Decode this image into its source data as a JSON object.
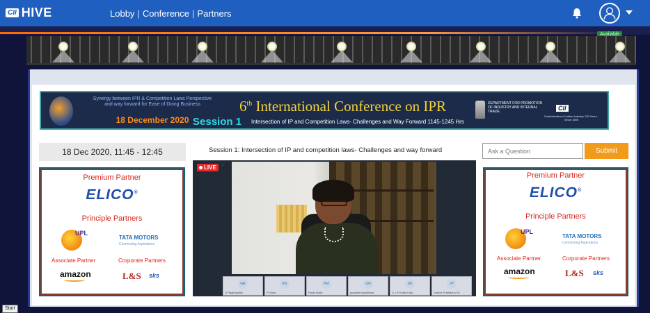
{
  "header": {
    "logo_badge": "CII",
    "logo_text": "HIVE",
    "nav": [
      {
        "label": "Lobby"
      },
      {
        "label": "Conference"
      },
      {
        "label": "Partners"
      }
    ],
    "nav_separator": "|",
    "bell_icon": "bell-icon",
    "avatar_icon": "user-avatar-icon",
    "accent_color": "#1f5fbf"
  },
  "stage": {
    "status_badge": "Available"
  },
  "banner": {
    "synergy_text": "Synergy between IPR & Competition Laws Perspective and way forward for Ease of Doing Business",
    "date": "18 December 2020",
    "title_num": "6",
    "title_sup": "th",
    "title_rest": " International Conference on IPR",
    "session": "Session 1",
    "subtitle": "Intersection of IP and Competition Laws- Challenges and Way Forward 1145-1245 Hrs",
    "dept_text": "DEPARTMENT FOR PROMOTION OF INDUSTRY AND INTERNAL TRADE",
    "cii_badge": "CII",
    "cii_sub": "Confederation of Indian Industry 125 Years - Since 1895"
  },
  "session": {
    "datetime": "18 Dec 2020, 11:45 - 12:45",
    "title": "Session 1: Intersection of IP and competition laws- Challenges and way forward"
  },
  "video": {
    "live_label": "LIVE",
    "participants": [
      {
        "initials": "GR",
        "name": "G Raghupathy"
      },
      {
        "initials": "RS",
        "name": "R Saha"
      },
      {
        "initials": "PM",
        "name": "Payal Malik"
      },
      {
        "initials": "GN",
        "name": "gowatmi rapohtana"
      },
      {
        "initials": "SK",
        "name": "S J R Kutty Kutty"
      },
      {
        "initials": "JP",
        "name": "Justice Prathiba M Si"
      }
    ]
  },
  "ask": {
    "placeholder": "Ask a Question",
    "submit_label": "Submit",
    "submit_color": "#f29a1a"
  },
  "partners": {
    "premium_label": "Premium Partner",
    "premium_brand": "ELICO",
    "registered": "®",
    "principle_label": "Principle Partners",
    "upl": "UPL",
    "tata": "TATA MOTORS",
    "tata_tagline": "Connecting Aspirations",
    "associate_label": "Associate Partner",
    "associate_brand": "amazon",
    "corporate_label": "Corporate Partners",
    "corp_brand_1": "L&S",
    "corp_brand_2": "sks"
  },
  "taskbar": {
    "start": "Start"
  }
}
